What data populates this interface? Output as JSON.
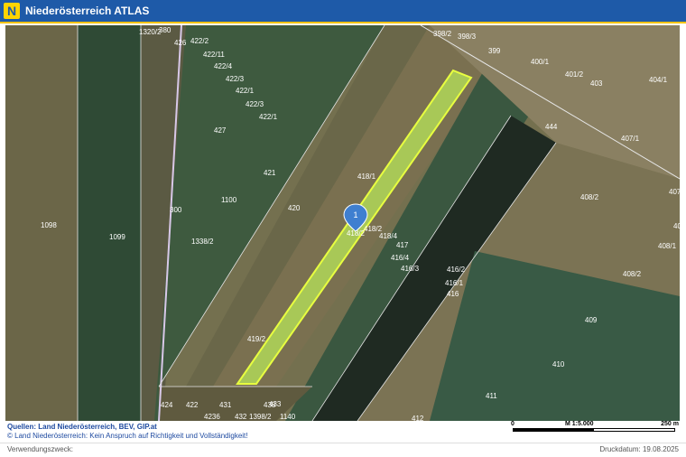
{
  "header": {
    "title": "Niederösterreich ATLAS",
    "logo_letter": "N"
  },
  "map": {
    "parcel_labels": [
      "1320/2",
      "380",
      "426",
      "422/2",
      "422/11",
      "422/4",
      "422/3",
      "422/1",
      "422/3",
      "422/1",
      "427",
      "421",
      "1100",
      "300",
      "420",
      "418/1",
      "1098",
      "1099",
      "1338/2",
      "418/2",
      "418/4",
      "417",
      "416/4",
      "416/3",
      "416/2",
      "416/1",
      "416",
      "419/2",
      "398/2",
      "398/3",
      "399",
      "400/1",
      "401/2",
      "403",
      "404/1",
      "444",
      "407/1",
      "408/2",
      "407/2",
      "407/3",
      "408/1",
      "408/2",
      "409",
      "410",
      "411",
      "412",
      "424",
      "422",
      "4236",
      "431",
      "432",
      "1398/2",
      "438",
      "1140",
      "433"
    ],
    "marker": {
      "number": "1",
      "label": "418/2"
    },
    "highlight_color": "#c8f070"
  },
  "footer": {
    "sources": "Quellen: Land Niederösterreich, BEV, GIP.at",
    "disclaimer": "© Land Niederösterreich: Kein Anspruch auf Richtigkeit und Vollständigkeit!",
    "purpose_label": "Verwendungszweck:",
    "print_date": "Druckdatum: 19.08.2025"
  },
  "scalebar": {
    "start": "0",
    "scale": "M 1:5.000",
    "end": "250 m"
  }
}
